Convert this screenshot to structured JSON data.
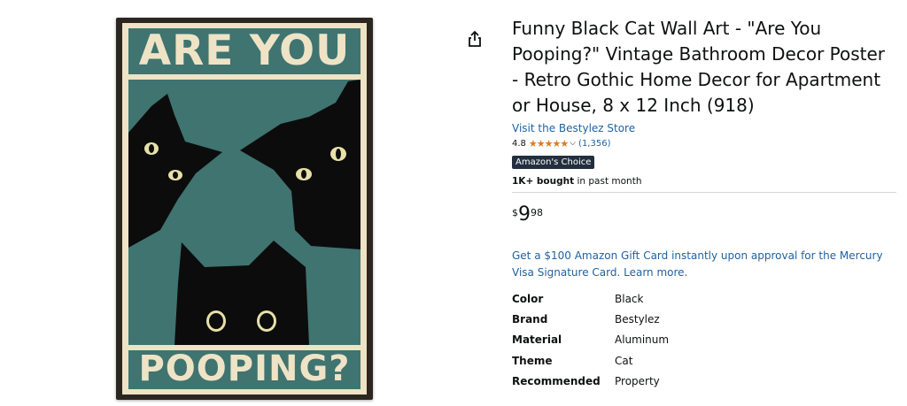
{
  "poster": {
    "top_text": "ARE YOU",
    "bottom_text": "POOPING?",
    "colors": {
      "background": "#3f7470",
      "frame": "#2b2620",
      "text": "#efe3c6",
      "cats": "#0c0c0c",
      "eyes": "#e8e0a8"
    }
  },
  "share": {
    "icon": "share-icon"
  },
  "product": {
    "title": "Funny Black Cat Wall Art - \"Are You Pooping?\" Vintage Bathroom Decor Poster - Retro Gothic Home Decor for Apartment or House, 8 x 12 Inch (918)",
    "store_link": "Visit the Bestylez Store",
    "rating": "4.8",
    "stars": "★★★★★",
    "rating_count": "(1,356)",
    "badge": "Amazon's Choice",
    "bought_bold": "1K+ bought",
    "bought_rest": " in past month",
    "price": {
      "symbol": "$",
      "whole": "9",
      "fraction": "98"
    },
    "promo": "Get a $100 Amazon Gift Card instantly upon approval for the Mercury Visa Signature Card. Learn more.",
    "specs": [
      {
        "label": "Color",
        "value": "Black"
      },
      {
        "label": "Brand",
        "value": "Bestylez"
      },
      {
        "label": "Material",
        "value": "Aluminum"
      },
      {
        "label": "Theme",
        "value": "Cat"
      },
      {
        "label": "Recommended",
        "value": "Property"
      }
    ]
  },
  "colors": {
    "link": "#2162a1",
    "star": "#de7921",
    "badge_bg": "#232f3e"
  }
}
